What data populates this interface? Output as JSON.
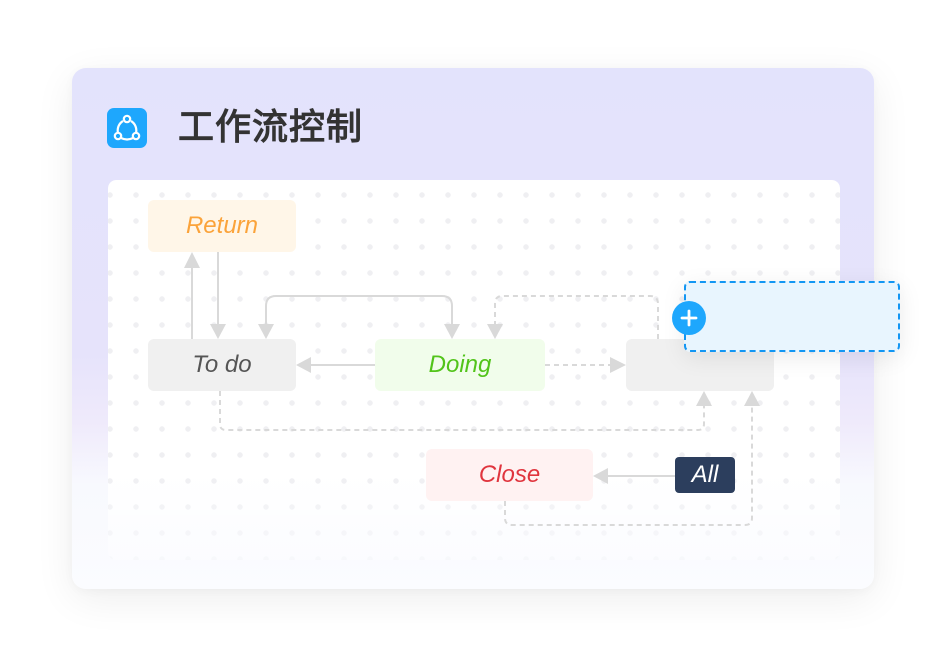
{
  "header": {
    "title": "工作流控制",
    "icon": "share-nodes-icon"
  },
  "colors": {
    "accent": "#1ea7fd",
    "return_text": "#fba33a",
    "doing_text": "#52c41a",
    "close_text": "#e0353e",
    "all_bg": "#2c3e5d"
  },
  "workflow": {
    "nodes": [
      {
        "id": "return",
        "label": "Return"
      },
      {
        "id": "todo",
        "label": "To do"
      },
      {
        "id": "doing",
        "label": "Doing"
      },
      {
        "id": "unnamed",
        "label": ""
      },
      {
        "id": "close",
        "label": "Close"
      },
      {
        "id": "all",
        "label": "All"
      }
    ],
    "edges": [
      {
        "from": "todo",
        "to": "return",
        "style": "solid"
      },
      {
        "from": "return",
        "to": "todo",
        "style": "solid"
      },
      {
        "from": "doing",
        "to": "todo",
        "style": "solid"
      },
      {
        "from": "todo",
        "to": "doing",
        "style": "solid"
      },
      {
        "from": "unnamed",
        "to": "doing",
        "style": "dashed"
      },
      {
        "from": "doing",
        "to": "unnamed",
        "style": "dashed"
      },
      {
        "from": "todo",
        "to": "unnamed",
        "style": "dashed"
      },
      {
        "from": "close",
        "to": "unnamed",
        "style": "dashed"
      },
      {
        "from": "all",
        "to": "close",
        "style": "solid"
      }
    ],
    "new_node": {
      "add_icon": "plus-icon"
    }
  }
}
